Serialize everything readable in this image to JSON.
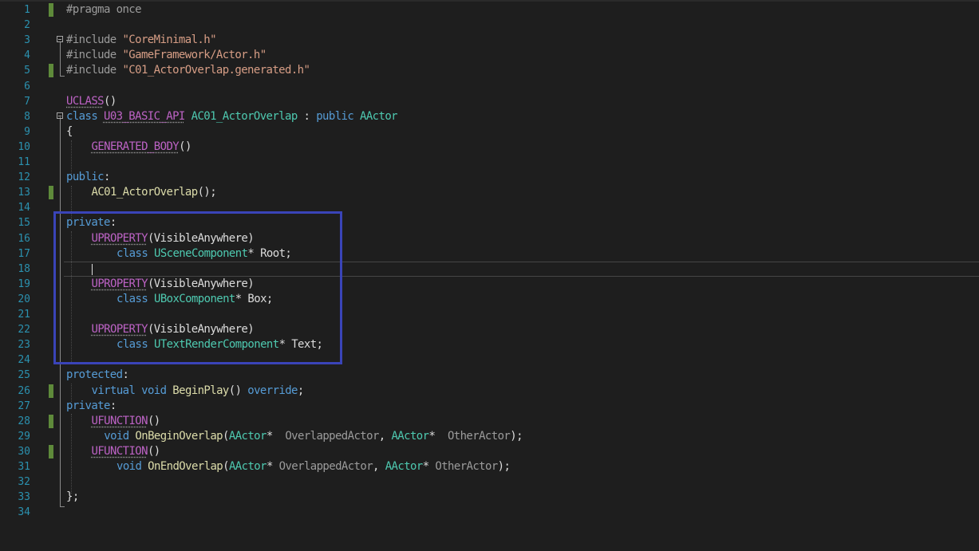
{
  "editor": {
    "lines": [
      {
        "n": "1",
        "changed": true,
        "fold": false,
        "tokens": [
          {
            "c": "pp",
            "t": "#pragma once"
          }
        ]
      },
      {
        "n": "2",
        "changed": false,
        "fold": false,
        "tokens": []
      },
      {
        "n": "3",
        "changed": false,
        "fold": true,
        "tokens": [
          {
            "c": "pp",
            "t": "#include "
          },
          {
            "c": "str",
            "t": "\"CoreMinimal.h\""
          }
        ]
      },
      {
        "n": "4",
        "changed": false,
        "fold": false,
        "tokens": [
          {
            "c": "pp",
            "t": "#include "
          },
          {
            "c": "str",
            "t": "\"GameFramework/Actor.h\""
          }
        ]
      },
      {
        "n": "5",
        "changed": true,
        "fold": false,
        "tokens": [
          {
            "c": "pp",
            "t": "#include "
          },
          {
            "c": "str",
            "t": "\"C01_ActorOverlap.generated.h\""
          }
        ]
      },
      {
        "n": "6",
        "changed": false,
        "fold": false,
        "tokens": []
      },
      {
        "n": "7",
        "changed": false,
        "fold": false,
        "tokens": [
          {
            "c": "mac squig",
            "t": "UCLASS"
          },
          {
            "c": "txt",
            "t": "()"
          }
        ]
      },
      {
        "n": "8",
        "changed": false,
        "fold": true,
        "tokens": [
          {
            "c": "kw",
            "t": "class "
          },
          {
            "c": "mac squig",
            "t": "U03_BASIC_API"
          },
          {
            "c": "txt",
            "t": " "
          },
          {
            "c": "ty",
            "t": "AC01_ActorOverlap"
          },
          {
            "c": "txt",
            "t": " : "
          },
          {
            "c": "kw",
            "t": "public "
          },
          {
            "c": "ty",
            "t": "AActor"
          }
        ]
      },
      {
        "n": "9",
        "changed": false,
        "fold": false,
        "tokens": [
          {
            "c": "txt",
            "t": "{"
          }
        ]
      },
      {
        "n": "10",
        "changed": false,
        "fold": false,
        "indent": 1,
        "tokens": [
          {
            "c": "mac squig",
            "t": "GENERATED_BODY"
          },
          {
            "c": "txt",
            "t": "()"
          }
        ]
      },
      {
        "n": "11",
        "changed": false,
        "fold": false,
        "tokens": []
      },
      {
        "n": "12",
        "changed": false,
        "fold": false,
        "tokens": [
          {
            "c": "kw",
            "t": "public"
          },
          {
            "c": "txt",
            "t": ":"
          }
        ]
      },
      {
        "n": "13",
        "changed": true,
        "fold": false,
        "indent": 1,
        "tokens": [
          {
            "c": "fn",
            "t": "AC01_ActorOverlap"
          },
          {
            "c": "txt",
            "t": "();"
          }
        ]
      },
      {
        "n": "14",
        "changed": false,
        "fold": false,
        "tokens": []
      },
      {
        "n": "15",
        "changed": false,
        "fold": false,
        "tokens": [
          {
            "c": "kw",
            "t": "private"
          },
          {
            "c": "txt",
            "t": ":"
          }
        ]
      },
      {
        "n": "16",
        "changed": false,
        "fold": false,
        "indent": 1,
        "tokens": [
          {
            "c": "mac squig",
            "t": "UPROPERTY"
          },
          {
            "c": "txt",
            "t": "(VisibleAnywhere)"
          }
        ]
      },
      {
        "n": "17",
        "changed": false,
        "fold": false,
        "indent": 2,
        "tokens": [
          {
            "c": "kw",
            "t": "class "
          },
          {
            "c": "ty",
            "t": "USceneComponent"
          },
          {
            "c": "txt",
            "t": "* Root;"
          }
        ]
      },
      {
        "n": "18",
        "changed": false,
        "fold": false,
        "tokens": []
      },
      {
        "n": "19",
        "changed": false,
        "fold": false,
        "indent": 1,
        "tokens": [
          {
            "c": "mac squig",
            "t": "UPROPERTY"
          },
          {
            "c": "txt",
            "t": "(VisibleAnywhere)"
          }
        ]
      },
      {
        "n": "20",
        "changed": false,
        "fold": false,
        "indent": 2,
        "tokens": [
          {
            "c": "kw",
            "t": "class "
          },
          {
            "c": "ty",
            "t": "UBoxComponent"
          },
          {
            "c": "txt",
            "t": "* Box;"
          }
        ]
      },
      {
        "n": "21",
        "changed": false,
        "fold": false,
        "tokens": []
      },
      {
        "n": "22",
        "changed": false,
        "fold": false,
        "indent": 1,
        "tokens": [
          {
            "c": "mac squig",
            "t": "UPROPERTY"
          },
          {
            "c": "txt",
            "t": "(VisibleAnywhere)"
          }
        ]
      },
      {
        "n": "23",
        "changed": false,
        "fold": false,
        "indent": 2,
        "tokens": [
          {
            "c": "kw",
            "t": "class "
          },
          {
            "c": "ty",
            "t": "UTextRenderComponent"
          },
          {
            "c": "txt",
            "t": "* Text;"
          }
        ]
      },
      {
        "n": "24",
        "changed": false,
        "fold": false,
        "tokens": []
      },
      {
        "n": "25",
        "changed": false,
        "fold": false,
        "tokens": [
          {
            "c": "kw",
            "t": "protected"
          },
          {
            "c": "txt",
            "t": ":"
          }
        ]
      },
      {
        "n": "26",
        "changed": true,
        "fold": false,
        "indent": 1,
        "tokens": [
          {
            "c": "kw",
            "t": "virtual void "
          },
          {
            "c": "fn",
            "t": "BeginPlay"
          },
          {
            "c": "txt",
            "t": "() "
          },
          {
            "c": "kw",
            "t": "override"
          },
          {
            "c": "txt",
            "t": ";"
          }
        ]
      },
      {
        "n": "27",
        "changed": false,
        "fold": false,
        "tokens": [
          {
            "c": "kw",
            "t": "private"
          },
          {
            "c": "txt",
            "t": ":"
          }
        ]
      },
      {
        "n": "28",
        "changed": true,
        "fold": false,
        "indent": 1,
        "tokens": [
          {
            "c": "mac squig",
            "t": "UFUNCTION"
          },
          {
            "c": "txt",
            "t": "()"
          }
        ]
      },
      {
        "n": "29",
        "changed": false,
        "fold": false,
        "indent": 1.5,
        "tokens": [
          {
            "c": "kw",
            "t": "void "
          },
          {
            "c": "fn",
            "t": "OnBeginOverlap"
          },
          {
            "c": "txt",
            "t": "("
          },
          {
            "c": "ty",
            "t": "AActor"
          },
          {
            "c": "txt",
            "t": "*  "
          },
          {
            "c": "pp",
            "t": "OverlappedActor"
          },
          {
            "c": "txt",
            "t": ", "
          },
          {
            "c": "ty",
            "t": "AActor"
          },
          {
            "c": "txt",
            "t": "*  "
          },
          {
            "c": "pp",
            "t": "OtherActor"
          },
          {
            "c": "txt",
            "t": ");"
          }
        ]
      },
      {
        "n": "30",
        "changed": true,
        "fold": false,
        "indent": 1,
        "tokens": [
          {
            "c": "mac squig",
            "t": "UFUNCTION"
          },
          {
            "c": "txt",
            "t": "()"
          }
        ]
      },
      {
        "n": "31",
        "changed": false,
        "fold": false,
        "indent": 2,
        "tokens": [
          {
            "c": "kw",
            "t": "void "
          },
          {
            "c": "fn",
            "t": "OnEndOverlap"
          },
          {
            "c": "txt",
            "t": "("
          },
          {
            "c": "ty",
            "t": "AActor"
          },
          {
            "c": "txt",
            "t": "* "
          },
          {
            "c": "pp",
            "t": "OverlappedActor"
          },
          {
            "c": "txt",
            "t": ", "
          },
          {
            "c": "ty",
            "t": "AActor"
          },
          {
            "c": "txt",
            "t": "* "
          },
          {
            "c": "pp",
            "t": "OtherActor"
          },
          {
            "c": "txt",
            "t": ");"
          }
        ]
      },
      {
        "n": "32",
        "changed": false,
        "fold": false,
        "tokens": []
      },
      {
        "n": "33",
        "changed": false,
        "fold": false,
        "tokens": [
          {
            "c": "txt",
            "t": "};"
          }
        ]
      },
      {
        "n": "34",
        "changed": false,
        "fold": false,
        "tokens": []
      }
    ],
    "current_line": "18",
    "colors": {
      "background": "#1e1e1e",
      "line_number": "#2b91af",
      "keyword": "#569cd6",
      "type": "#4ec9b0",
      "preprocessor": "#9b9b9b",
      "string": "#d69d85",
      "macro": "#bd63c5",
      "function": "#dcdcaa",
      "change_marker": "#5e8a3a",
      "highlight_box": "#3a44b8"
    }
  }
}
